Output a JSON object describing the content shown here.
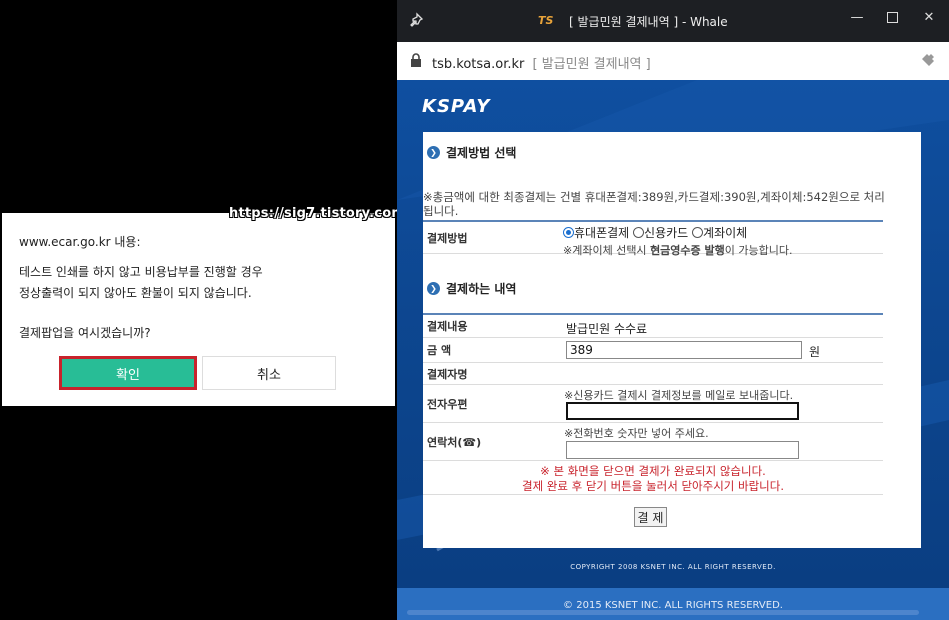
{
  "dialog": {
    "origin": "www.ecar.go.kr 내용:",
    "lines": [
      "테스트 인쇄를 하지 않고 비용납부를 진행할 경우",
      "정상출력이 되지 않아도 환불이 되지 않습니다.",
      "결제팝업을 여시겠습니까?"
    ],
    "ok_label": "확인",
    "cancel_label": "취소"
  },
  "watermark": "https://sig7.tistory.com",
  "window": {
    "title": "[ 발급민원 결제내역 ] - Whale",
    "logo_text": "TS",
    "url": "tsb.kotsa.or.kr",
    "url_title": "[ 발급민원 결제내역 ]"
  },
  "kspay": {
    "logo": "KSPAY",
    "section1_title": "결제방법 선택",
    "notice": "※총금액에 대한 최종결제는 건별 휴대폰결제:389원,카드결제:390원,계좌이체:542원으로 처리됩니다.",
    "method_label": "결제방법",
    "methods": [
      "휴대폰결제",
      "신용카드",
      "계좌이체"
    ],
    "selected_method": "휴대폰결제",
    "method_note_prefix": "※계좌이체 선택시 ",
    "method_note_bold": "현금영수증 발행",
    "method_note_suffix": "이 가능합니다.",
    "section2_title": "결제하는 내역",
    "rows": {
      "content_label": "결제내용",
      "content_value": "발급민원 수수료",
      "amount_label": "금      액",
      "amount_value": "389",
      "amount_unit": "원",
      "payer_label": "결제자명",
      "email_label": "전자우편",
      "email_note": "※신용카드 결제시 결제정보를 메일로 보내줍니다.",
      "phone_label": "연락처(☎)",
      "phone_note": "※전화번호 숫자만 넣어 주세요."
    },
    "warning1": "※ 본 화면을 닫으면 결제가 완료되지 않습니다.",
    "warning2": "결제 완료 후 닫기 버튼을 눌러서 닫아주시기 바랍니다.",
    "pay_button": "결 제",
    "copyright1": "COPYRIGHT 2008 KSNET INC. ALL RIGHT RESERVED.",
    "copyright2": "© 2015 KSNET INC. ALL RIGHTS RESERVED."
  },
  "colors": {
    "ok_button": "#28bd96",
    "ok_border": "#c8232c",
    "page_blue": "#0d4791",
    "warning_red": "#c8232c"
  }
}
